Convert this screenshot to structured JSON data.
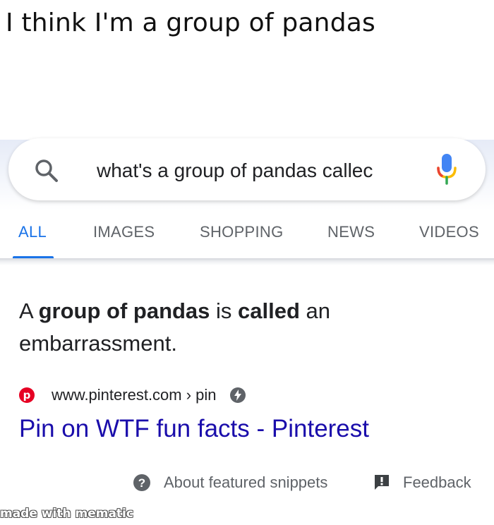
{
  "meme": {
    "caption": "I think I'm a group of pandas",
    "watermark": "made with mematic"
  },
  "search": {
    "query": "what's a group of pandas callec",
    "search_icon": "search-icon",
    "mic_icon": "mic-icon"
  },
  "tabs": [
    {
      "label": "ALL",
      "active": true
    },
    {
      "label": "IMAGES",
      "active": false
    },
    {
      "label": "SHOPPING",
      "active": false
    },
    {
      "label": "NEWS",
      "active": false
    },
    {
      "label": "VIDEOS",
      "active": false
    }
  ],
  "featured_snippet": {
    "answer_parts": [
      "A ",
      "group of pandas",
      " is ",
      "called",
      " an embarrassment."
    ],
    "source_url": "www.pinterest.com › pin",
    "source_icon": "pinterest-logo",
    "amp_icon": "amp-lightning-icon",
    "title": "Pin on WTF fun facts - Pinterest"
  },
  "footer": {
    "about_label": "About featured snippets",
    "feedback_label": "Feedback",
    "help_icon": "question-circle-icon",
    "feedback_icon": "feedback-icon"
  },
  "colors": {
    "link_blue": "#1a0dab",
    "tab_active": "#1a73e8",
    "tab_inactive": "#5f6368",
    "pinterest_red": "#e60023"
  }
}
